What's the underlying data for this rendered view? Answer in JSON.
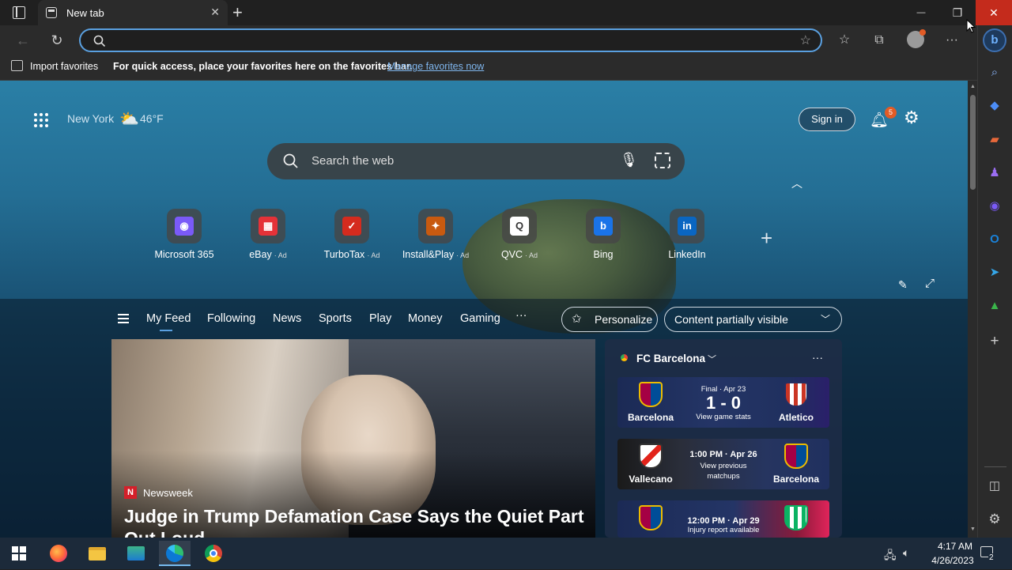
{
  "browser": {
    "tab_title": "New tab",
    "tab_close": "✕",
    "new_tab": "+",
    "minimize": "—",
    "restore": "❐",
    "close": "✕"
  },
  "toolbar": {
    "address_value": "",
    "more": "···"
  },
  "favorites_bar": {
    "import_label": "Import favorites",
    "message": "For quick access, place your favorites here on the favorites bar.",
    "manage_link": "Manage favorites now"
  },
  "top": {
    "city": "New York",
    "temperature": "46°F",
    "sign_in": "Sign in",
    "notif_count": "5"
  },
  "search": {
    "placeholder": "Search the web"
  },
  "quick_links": [
    {
      "label": "Microsoft 365",
      "ad": "",
      "icon": "microsoft-365-icon",
      "color": "#7a5af8"
    },
    {
      "label": "eBay",
      "ad": "· Ad",
      "icon": "ebay-icon",
      "color": "#e53238"
    },
    {
      "label": "TurboTax",
      "ad": "· Ad",
      "icon": "turbotax-icon",
      "color": "#d52b1e"
    },
    {
      "label": "Install&Play",
      "ad": "· Ad",
      "icon": "install-play-icon",
      "color": "#c85a10"
    },
    {
      "label": "QVC",
      "ad": "· Ad",
      "icon": "qvc-icon",
      "color": "#ffffff"
    },
    {
      "label": "Bing",
      "ad": "",
      "icon": "bing-icon",
      "color": "#1a73e8"
    },
    {
      "label": "LinkedIn",
      "ad": "",
      "icon": "linkedin-icon",
      "color": "#0a66c2"
    }
  ],
  "feed_nav": [
    "My Feed",
    "Following",
    "News",
    "Sports",
    "Play",
    "Money",
    "Gaming"
  ],
  "feed_more": "···",
  "personalize": "Personalize",
  "visibility": "Content partially visible",
  "hero": {
    "source": "Newsweek",
    "source_letter": "N",
    "headline": "Judge in Trump Defamation Case Says the Quiet Part Out Loud"
  },
  "widget": {
    "title": "FC Barcelona",
    "more": "···",
    "matches": [
      {
        "home": "Barcelona",
        "away": "Atletico",
        "status": "Final · Apr 23",
        "score": "1 - 0",
        "sub": "View game stats"
      },
      {
        "home": "Vallecano",
        "away": "Barcelona",
        "status": "1:00 PM · Apr 26",
        "score": "",
        "sub": "View previous matchups"
      },
      {
        "home": "",
        "away": "",
        "status": "12:00 PM · Apr 29",
        "score": "",
        "sub": "Injury report available"
      }
    ]
  },
  "taskbar": {
    "time": "4:17 AM",
    "date": "4/26/2023",
    "notif_count": "2"
  },
  "colors": {
    "accent": "#5aa0e0",
    "link": "#7fb6ee",
    "badge": "#e25b25"
  }
}
